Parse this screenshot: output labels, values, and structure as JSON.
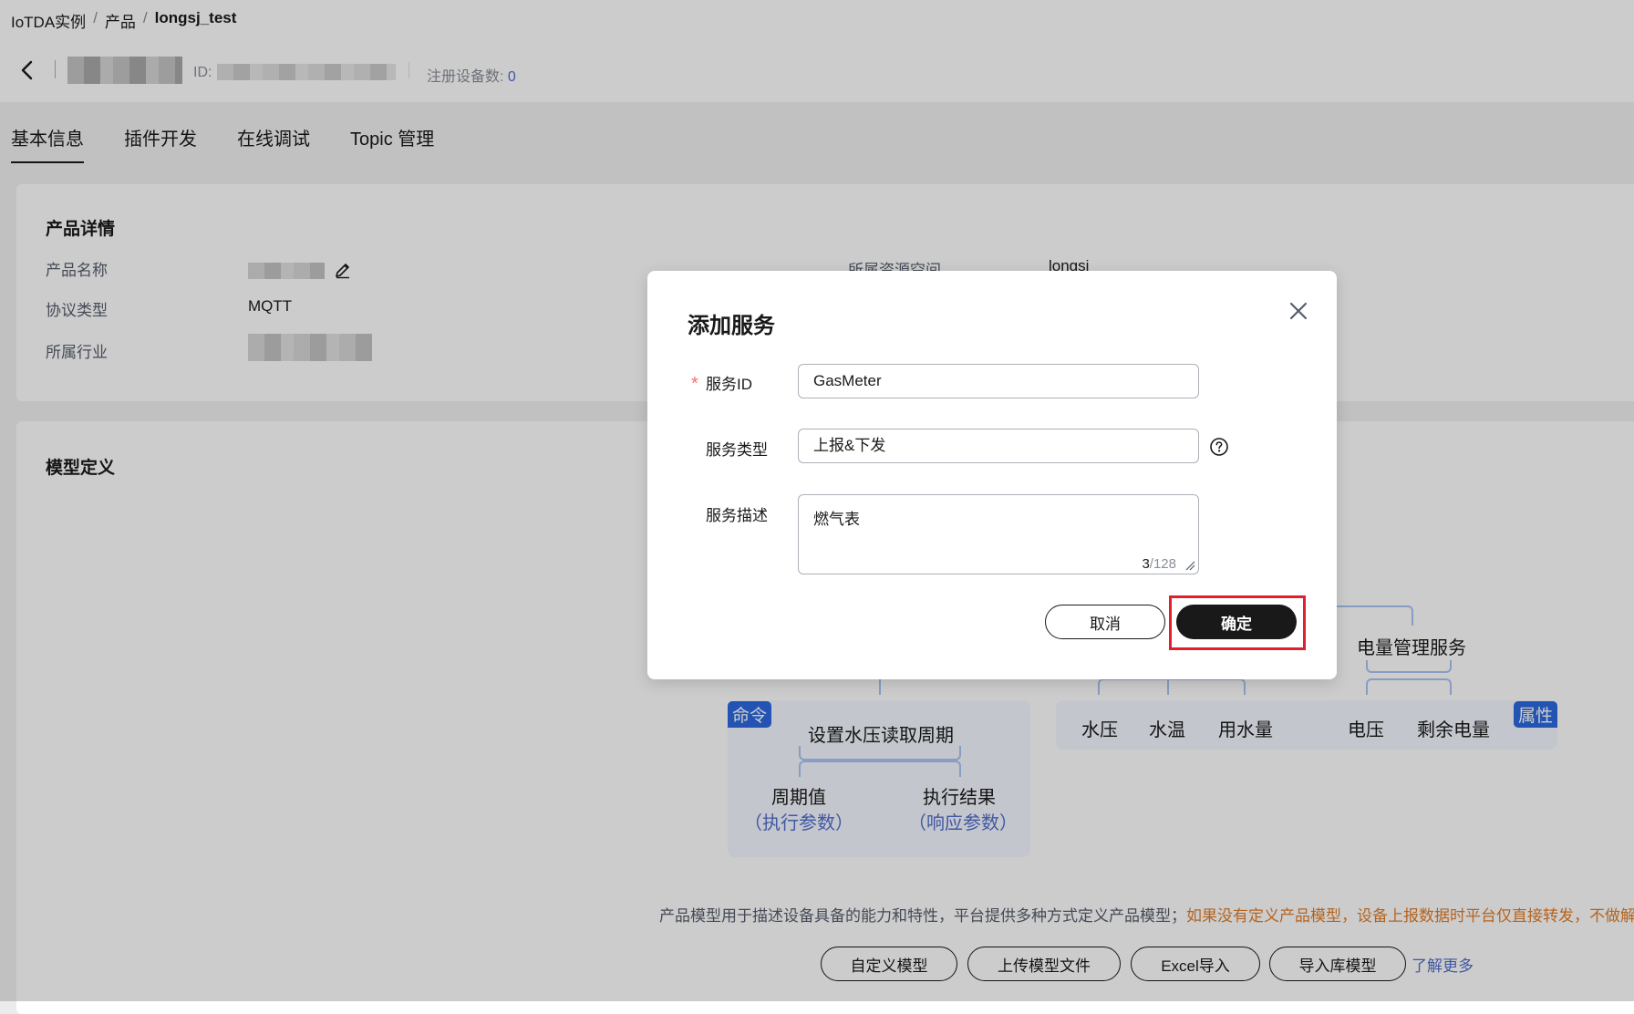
{
  "breadcrumb": {
    "root": "IoTDA实例",
    "sep1": "/",
    "mid": "产品",
    "sep2": "/",
    "current": "longsj_test"
  },
  "header": {
    "id_label": "ID:",
    "device_count_label": "注册设备数:",
    "device_count": "0"
  },
  "tabs": [
    "基本信息",
    "插件开发",
    "在线调试",
    "Topic 管理"
  ],
  "product_details": {
    "title": "产品详情",
    "name_label": "产品名称",
    "protocol_label": "协议类型",
    "protocol_value": "MQTT",
    "industry_label": "所属行业",
    "resource_space_label": "所属资源空间",
    "resource_space_value": "longsj"
  },
  "model": {
    "title": "模型定义",
    "command_tag": "命令",
    "property_tag": "属性",
    "command_name": "设置水压读取周期",
    "param1": "周期值",
    "param1_type": "（执行参数）",
    "param2": "执行结果",
    "param2_type": "（响应参数）",
    "water_props": [
      "水压",
      "水温",
      "用水量"
    ],
    "power_service": "电量管理服务",
    "power_props": [
      "电压",
      "剩余电量"
    ],
    "desc": "产品模型用于描述设备具备的能力和特性，平台提供多种方式定义产品模型；",
    "desc_warn": "如果没有定义产品模型，设备上报数据时平台仅直接转发，不做解析",
    "buttons": [
      "自定义模型",
      "上传模型文件",
      "Excel导入",
      "导入库模型"
    ],
    "learn_more": "了解更多"
  },
  "dialog": {
    "title": "添加服务",
    "required_mark": "*",
    "service_id_label": "服务ID",
    "service_id_value": "GasMeter",
    "service_type_label": "服务类型",
    "service_type_value": "上报&下发",
    "service_desc_label": "服务描述",
    "service_desc_value": "燃气表",
    "desc_count": "3",
    "desc_max": "/128",
    "cancel": "取消",
    "confirm": "确定"
  }
}
